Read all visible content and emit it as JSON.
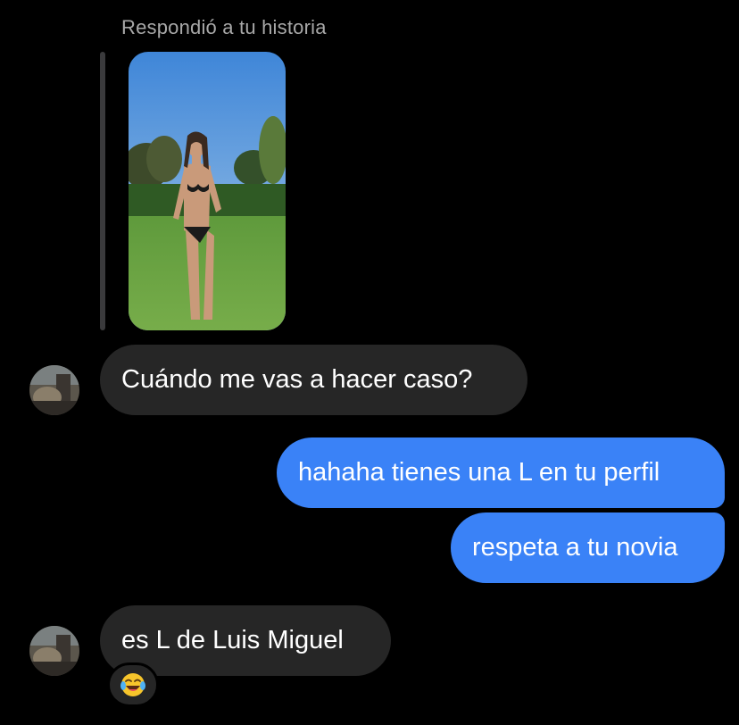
{
  "story_reply": {
    "label": "Respondió a tu historia"
  },
  "messages": [
    {
      "from": "them",
      "text": "Cuándo me vas a hacer caso?"
    },
    {
      "from": "me",
      "text": "hahaha tienes una L en tu perfil"
    },
    {
      "from": "me",
      "text": "respeta a tu novia"
    },
    {
      "from": "them",
      "text": "es L de Luis Miguel"
    }
  ],
  "reaction": {
    "emoji": "😂",
    "icon": "laughing-tears-emoji-icon"
  },
  "colors": {
    "background": "#000000",
    "incoming_bubble": "#262626",
    "outgoing_bubble": "#3a82f7",
    "muted_text": "#a8a8a8"
  }
}
